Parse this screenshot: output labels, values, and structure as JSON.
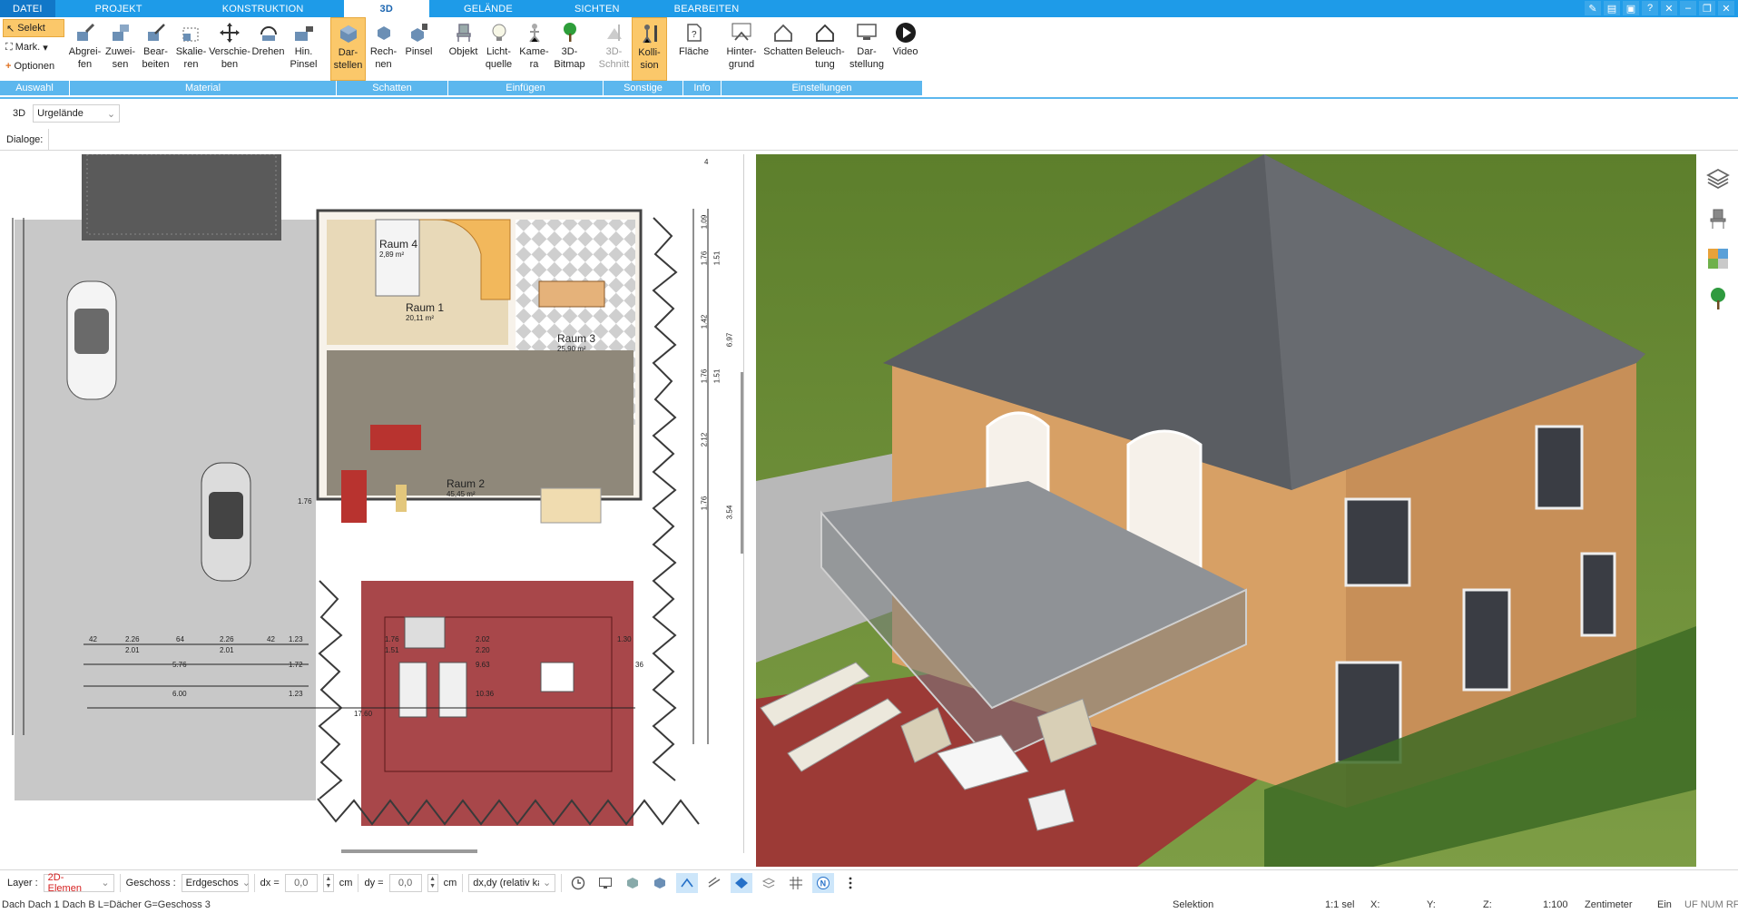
{
  "tabs": [
    {
      "label": "DATEI"
    },
    {
      "label": "PROJEKT"
    },
    {
      "label": "KONSTRUKTION"
    },
    {
      "label": "3D"
    },
    {
      "label": "GELÄNDE"
    },
    {
      "label": "SICHTEN"
    },
    {
      "label": "BEARBEITEN"
    }
  ],
  "selection": {
    "selekt": "Selekt",
    "mark": "Mark.",
    "optionen": "Optionen"
  },
  "ribbon_buttons": {
    "abgreifen": "Abgrei-\nfen",
    "zuweisen": "Zuwei-\nsen",
    "bearbeiten": "Bear-\nbeiten",
    "skalieren": "Skalie-\nren",
    "verschieben": "Verschie-\nben",
    "drehen": "Drehen",
    "hin_pinsel": "Hin.\nPinsel",
    "darstellen": "Dar-\nstellen",
    "rechnen": "Rech-\nnen",
    "pinsel": "Pinsel",
    "objekt": "Objekt",
    "lichtquelle": "Licht-\nquelle",
    "kamera": "Kame-\nra",
    "bitmap3d": "3D-\nBitmap",
    "schnitt3d": "3D-\nSchnitt",
    "kollision": "Kolli-\nsion",
    "flaeche": "Fläche",
    "hintergrund": "Hinter-\ngrund",
    "schatten": "Schatten",
    "beleuchtung": "Beleuch-\ntung",
    "darstellung": "Dar-\nstellung",
    "video": "Video"
  },
  "ribbon_groups": {
    "auswahl": "Auswahl",
    "material": "Material",
    "schatten": "Schatten",
    "einfuegen": "Einfügen",
    "sonstige": "Sonstige",
    "info": "Info",
    "einstellungen": "Einstellungen"
  },
  "view_toolbar": {
    "mode": "3D",
    "terrain_value": "Urgelände"
  },
  "dialoge_label": "Dialoge:",
  "floorplan": {
    "raum4": "Raum 4",
    "raum4_area": "2,89 m²",
    "raum1": "Raum 1",
    "raum1_area": "20,11 m²",
    "raum3": "Raum 3",
    "raum3_area": "25,90 m²",
    "raum2": "Raum 2",
    "raum2_area": "45,45 m²",
    "dims": [
      "2.26",
      "2.26",
      "2.01",
      "2.01",
      "5.76",
      "1.72",
      "6.00",
      "1.23",
      "1.23",
      "42",
      "64",
      "42",
      "1.76",
      "2.02",
      "1.51",
      "2.20",
      "1.30",
      "9.63",
      "10.36",
      "17.60",
      "1.76",
      "1.51",
      "1.76",
      "1.51",
      "1.76",
      "3.54",
      "2.12",
      "6.97",
      "1.42",
      "1.09",
      "1.76",
      "4",
      "36"
    ]
  },
  "bottombar": {
    "layer_label": "Layer :",
    "layer_value": "2D-Elemen",
    "geschoss_label": "Geschoss :",
    "geschoss_value": "Erdgeschos",
    "dx_label": "dx =",
    "dx_value": "0,0",
    "dx_unit": "cm",
    "dy_label": "dy =",
    "dy_value": "0,0",
    "dy_unit": "cm",
    "mode_value": "dx,dy (relativ ka"
  },
  "statusbar": {
    "left": "Dach Dach 1 Dach B L=Dächer G=Geschoss 3",
    "selektion": "Selektion",
    "sel_count": "1:1 sel",
    "x": "X:",
    "y": "Y:",
    "z": "Z:",
    "scale": "1:100",
    "unit": "Zentimeter",
    "ein": "Ein",
    "flags": "UF NUM RF"
  },
  "colors": {
    "ribbon_blue": "#1e9be8",
    "group_blue": "#5cb7ee",
    "active_orange": "#fbc86a"
  }
}
